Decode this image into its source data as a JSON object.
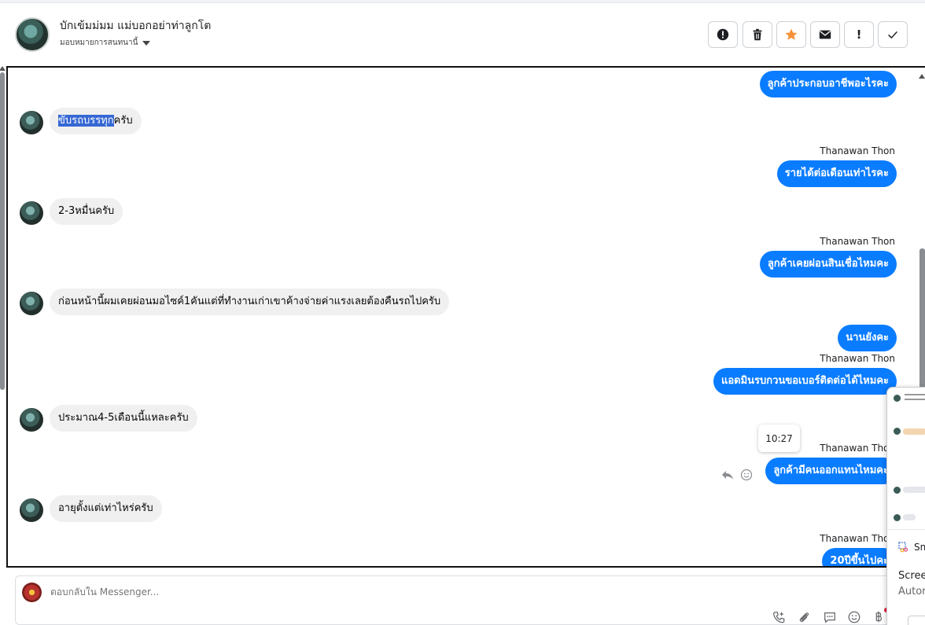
{
  "header": {
    "contact_name": "บักเข้มม่มม แม่บอกอย่าท่าลูกโต",
    "assign_label": "มอบหมายการสนทนานี้",
    "buttons": [
      {
        "name": "report-button",
        "icon": "exclamation-circle-icon"
      },
      {
        "name": "delete-button",
        "icon": "trash-icon"
      },
      {
        "name": "star-button",
        "icon": "star-icon",
        "color": "#f7923a"
      },
      {
        "name": "mark-unread-button",
        "icon": "envelope-icon"
      },
      {
        "name": "important-button",
        "icon": "exclamation-icon",
        "label": "!"
      },
      {
        "name": "done-button",
        "icon": "check-icon"
      }
    ]
  },
  "messages": [
    {
      "dir": "out",
      "text": "ลูกค้าประกอบอาชีพอะไรคะ"
    },
    {
      "dir": "in",
      "text_highlight": "ขับรถบรรทุก",
      "text_rest": "ครับ"
    },
    {
      "dir": "out",
      "sender": "Thanawan Thon",
      "text": "รายได้ต่อเดือนเท่าไรคะ"
    },
    {
      "dir": "in",
      "text": "2-3หมื่นครับ"
    },
    {
      "dir": "out",
      "sender": "Thanawan Thon",
      "text": "ลูกค้าเคยผ่อนสินเชื่อไหมคะ"
    },
    {
      "dir": "in",
      "text": "ก่อนหน้านี้ผมเคยผ่อนมอไซค์1คันแต่ที่ทำงานเก่าเขาค้างจ่ายค่าแรงเลยต้องคืนรถไปครับ"
    },
    {
      "dir": "out",
      "text": "นานยังคะ"
    },
    {
      "dir": "out",
      "sender": "Thanawan Thon",
      "text": "แอดมินรบกวนขอเบอร์ติดต่อได้ไหมคะ"
    },
    {
      "dir": "in",
      "text": "ประมาณ4-5เดือนนี้แหละครับ"
    },
    {
      "dir": "out",
      "sender": "Thanawan Thon",
      "text": "ลูกค้ามีคนออกแทนไหมคะ",
      "time": "10:27"
    },
    {
      "dir": "in",
      "text": "อายุตั้งแต่เท่าไหร่ครับ"
    },
    {
      "dir": "out",
      "sender": "Thanawan Thon",
      "text": "20ปีขึ้นไปคะ"
    }
  ],
  "composer": {
    "placeholder": "ตอบกลับใน Messenger..."
  },
  "popup": {
    "tool_label": "Sn",
    "title": "Scree",
    "subtitle": "Autor"
  },
  "colors": {
    "outgoing_bubble": "#0a7cff",
    "incoming_bubble": "#f0f0f0",
    "highlight": "#3668d4",
    "star": "#f7923a"
  }
}
